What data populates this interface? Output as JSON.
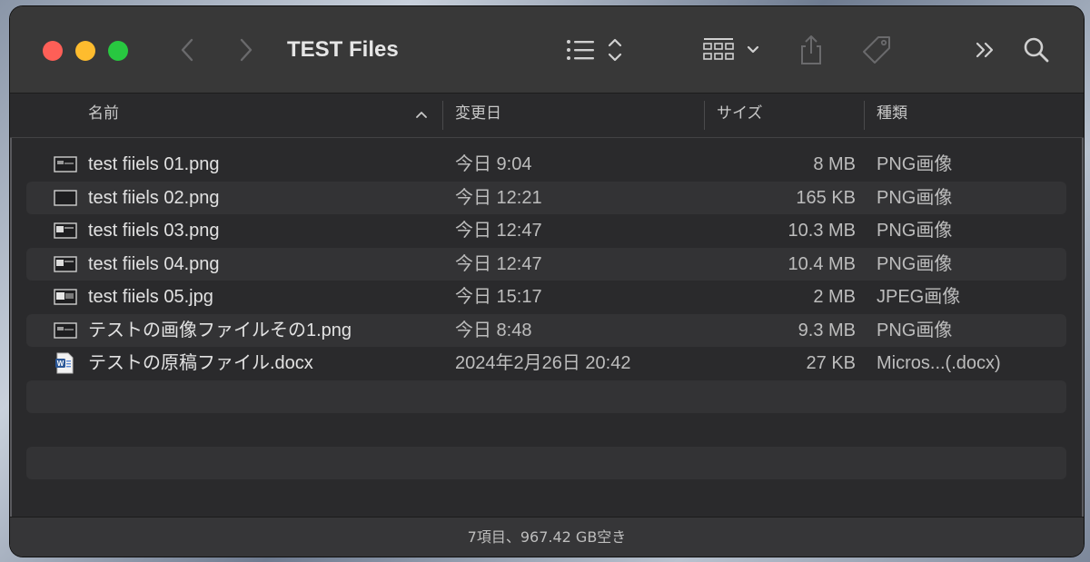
{
  "window": {
    "title": "TEST Files"
  },
  "toolbar": {
    "back_icon": "chevron-left-icon",
    "forward_icon": "chevron-right-icon",
    "view_icon": "list-view-icon",
    "group_icon": "grid-group-icon",
    "share_icon": "share-icon",
    "tag_icon": "tag-icon",
    "more_icon": "double-chevron-right-icon",
    "search_icon": "search-icon"
  },
  "columns": {
    "name": "名前",
    "date": "変更日",
    "size": "サイズ",
    "kind": "種類"
  },
  "files": [
    {
      "name": "test fiiels 01.png",
      "date": "今日 9:04",
      "size": "8 MB",
      "kind": "PNG画像",
      "icon": "png-thumbnail-icon"
    },
    {
      "name": "test fiiels 02.png",
      "date": "今日 12:21",
      "size": "165 KB",
      "kind": "PNG画像",
      "icon": "png-thumbnail-icon"
    },
    {
      "name": "test fiiels 03.png",
      "date": "今日 12:47",
      "size": "10.3 MB",
      "kind": "PNG画像",
      "icon": "png-thumbnail-icon"
    },
    {
      "name": "test fiiels 04.png",
      "date": "今日 12:47",
      "size": "10.4 MB",
      "kind": "PNG画像",
      "icon": "png-thumbnail-icon"
    },
    {
      "name": "test fiiels 05.jpg",
      "date": "今日 15:17",
      "size": "2 MB",
      "kind": "JPEG画像",
      "icon": "jpg-thumbnail-icon"
    },
    {
      "name": "テストの画像ファイルその1.png",
      "date": "今日 8:48",
      "size": "9.3 MB",
      "kind": "PNG画像",
      "icon": "png-thumbnail-icon"
    },
    {
      "name": "テストの原稿ファイル.docx",
      "date": "2024年2月26日 20:42",
      "size": "27 KB",
      "kind": "Micros...(.docx)",
      "icon": "word-document-icon"
    }
  ],
  "footer": {
    "status": "7項目、967.42 GB空き"
  },
  "colors": {
    "window_bg": "#2a2a2c",
    "toolbar_bg": "#383838",
    "alt_row": "#333335",
    "close": "#fe5f57",
    "minimize": "#febc2e",
    "zoom": "#28c840"
  }
}
